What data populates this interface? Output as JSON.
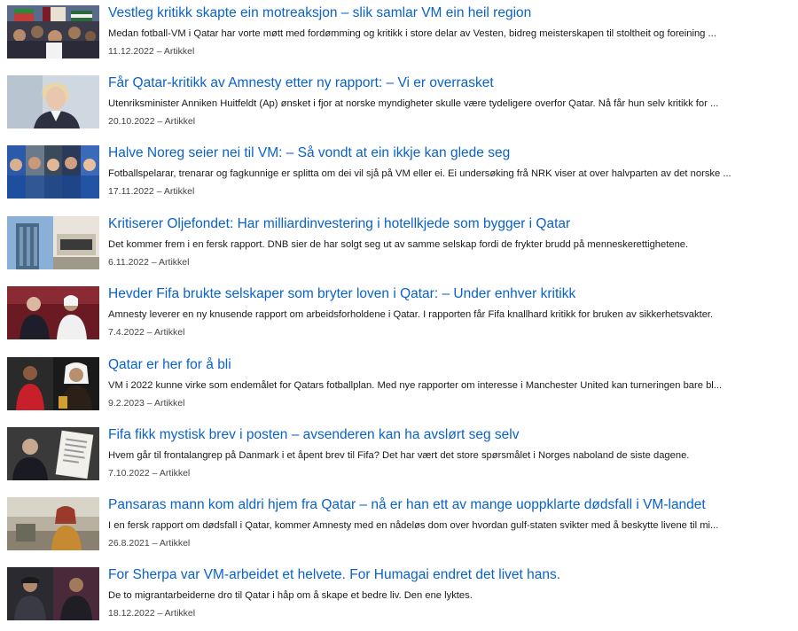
{
  "articles": [
    {
      "title": "Vestleg kritikk skapte ein motreaksjon – slik samlar VM ein heil region",
      "summary": "Medan fotball-VM i Qatar har vorte møtt med fordømming og kritikk i store delar av Vesten, bidreg meisterskapen til stoltheit og foreining ...",
      "date": "11.12.2022",
      "separator": "–",
      "type": "Artikkel",
      "image": "crowd-flags-image"
    },
    {
      "title": "Får Qatar-kritikk av Amnesty etter ny rapport: – Vi er overrasket",
      "summary": "Utenriksminister Anniken Huitfeldt (Ap) ønsket i fjor at norske myndigheter skulle være tydeligere overfor Qatar. Nå får hun selv kritikk for ...",
      "date": "20.10.2022",
      "separator": "–",
      "type": "Artikkel",
      "image": "politician-portrait-image"
    },
    {
      "title": "Halve Noreg seier nei til VM: – Så vondt at ein ikkje kan glede seg",
      "summary": "Fotballspelarar, trenarar og fagkunnige er splitta om dei vil sjå på VM eller ei. Ei undersøking frå NRK viser at over halvparten av det norske ...",
      "date": "17.11.2022",
      "separator": "–",
      "type": "Artikkel",
      "image": "player-collage-image"
    },
    {
      "title": "Kritiserer Oljefondet: Har milliardinvestering i hotellkjede som bygger i Qatar",
      "summary": "Det kommer frem i en fersk rapport. DNB sier de har solgt seg ut av samme selskap fordi de frykter brudd på menneskerettighetene.",
      "date": "6.11.2022",
      "separator": "–",
      "type": "Artikkel",
      "image": "hotel-buildings-image"
    },
    {
      "title": "Hevder Fifa brukte selskaper som bryter loven i Qatar: – Under enhver kritikk",
      "summary": "Amnesty leverer en ny knusende rapport om arbeidsforholdene i Qatar. I rapporten får Fifa knallhard kritikk for bruken av sikkerhetsvakter.",
      "date": "7.4.2022",
      "separator": "–",
      "type": "Artikkel",
      "image": "fifa-officials-image"
    },
    {
      "title": "Qatar er her for å bli",
      "summary": "VM i 2022 kunne virke som endemålet for Qatars fotballplan. Med nye rapporter om interesse i Manchester United kan turneringen bare bl...",
      "date": "9.2.2023",
      "separator": "–",
      "type": "Artikkel",
      "image": "player-and-sheikh-image"
    },
    {
      "title": "Fifa fikk mystisk brev i posten – avsenderen kan ha avslørt seg selv",
      "summary": "Hvem går til frontalangrep på Danmark i et åpent brev til Fifa? Det har vært det store spørsmålet i Norges naboland de siste dagene.",
      "date": "7.10.2022",
      "separator": "–",
      "type": "Artikkel",
      "image": "man-and-letter-image"
    },
    {
      "title": "Pansaras mann kom aldri hjem fra Qatar – nå er han ett av mange uoppklarte dødsfall i VM-landet",
      "summary": "I en fersk rapport om dødsfall i Qatar, kommer Amnesty med en nådeløs dom over hvordan gulf-staten svikter med å beskytte livene til mi...",
      "date": "26.8.2021",
      "separator": "–",
      "type": "Artikkel",
      "image": "woman-outdoors-image"
    },
    {
      "title": "For Sherpa var VM-arbeidet et helvete. For Humagai endret det livet hans.",
      "summary": "De to migrantarbeiderne dro til Qatar i håp om å skape et bedre liv. Den ene lyktes.",
      "date": "18.12.2022",
      "separator": "–",
      "type": "Artikkel",
      "image": "two-workers-image"
    }
  ],
  "colors": {
    "link": "#0a62c9",
    "text": "#1a1a1a",
    "meta": "#444444"
  }
}
